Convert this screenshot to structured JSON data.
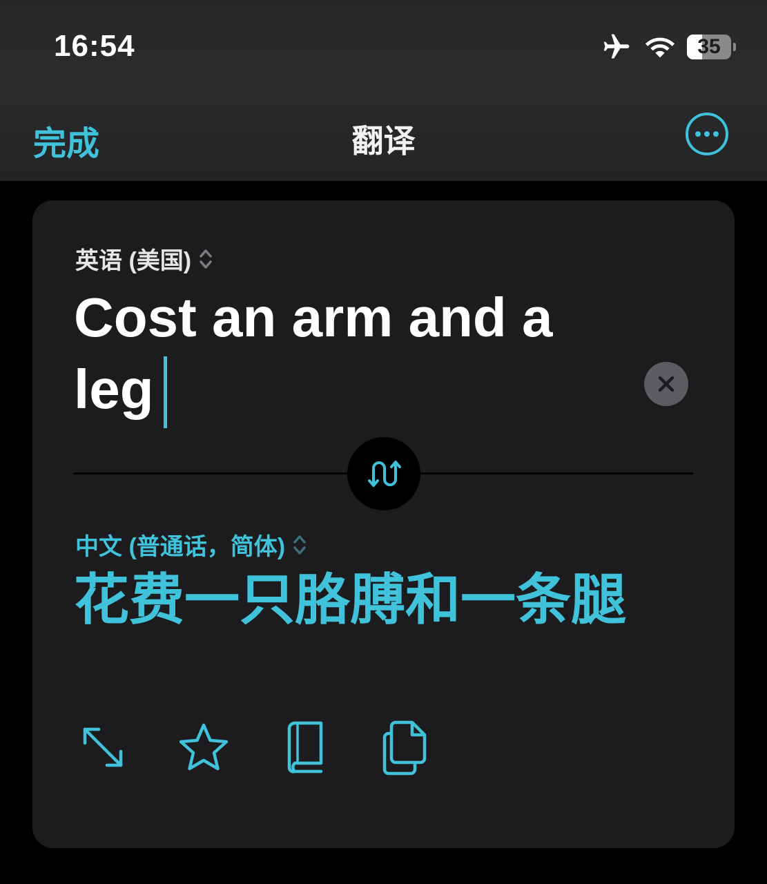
{
  "status_bar": {
    "time": "16:54",
    "battery_level": "35",
    "battery_fraction": 0.35,
    "icons": [
      "airplane-mode-icon",
      "wifi-icon",
      "battery-icon"
    ]
  },
  "nav": {
    "done_label": "完成",
    "title": "翻译",
    "more_icon": "ellipsis-circle-icon"
  },
  "source": {
    "language": "英语 (美国)",
    "text": "Cost an arm and a leg"
  },
  "target": {
    "language": "中文 (普通话，简体)",
    "text": "花费一只胳膊和一条腿"
  },
  "actions": [
    "expand-icon",
    "favorite-star-icon",
    "dictionary-book-icon",
    "copy-icon"
  ],
  "colors": {
    "accent": "#3fc2da",
    "card_background": "#1c1c1e",
    "page_background": "#000000",
    "header_background": "#27282a"
  }
}
